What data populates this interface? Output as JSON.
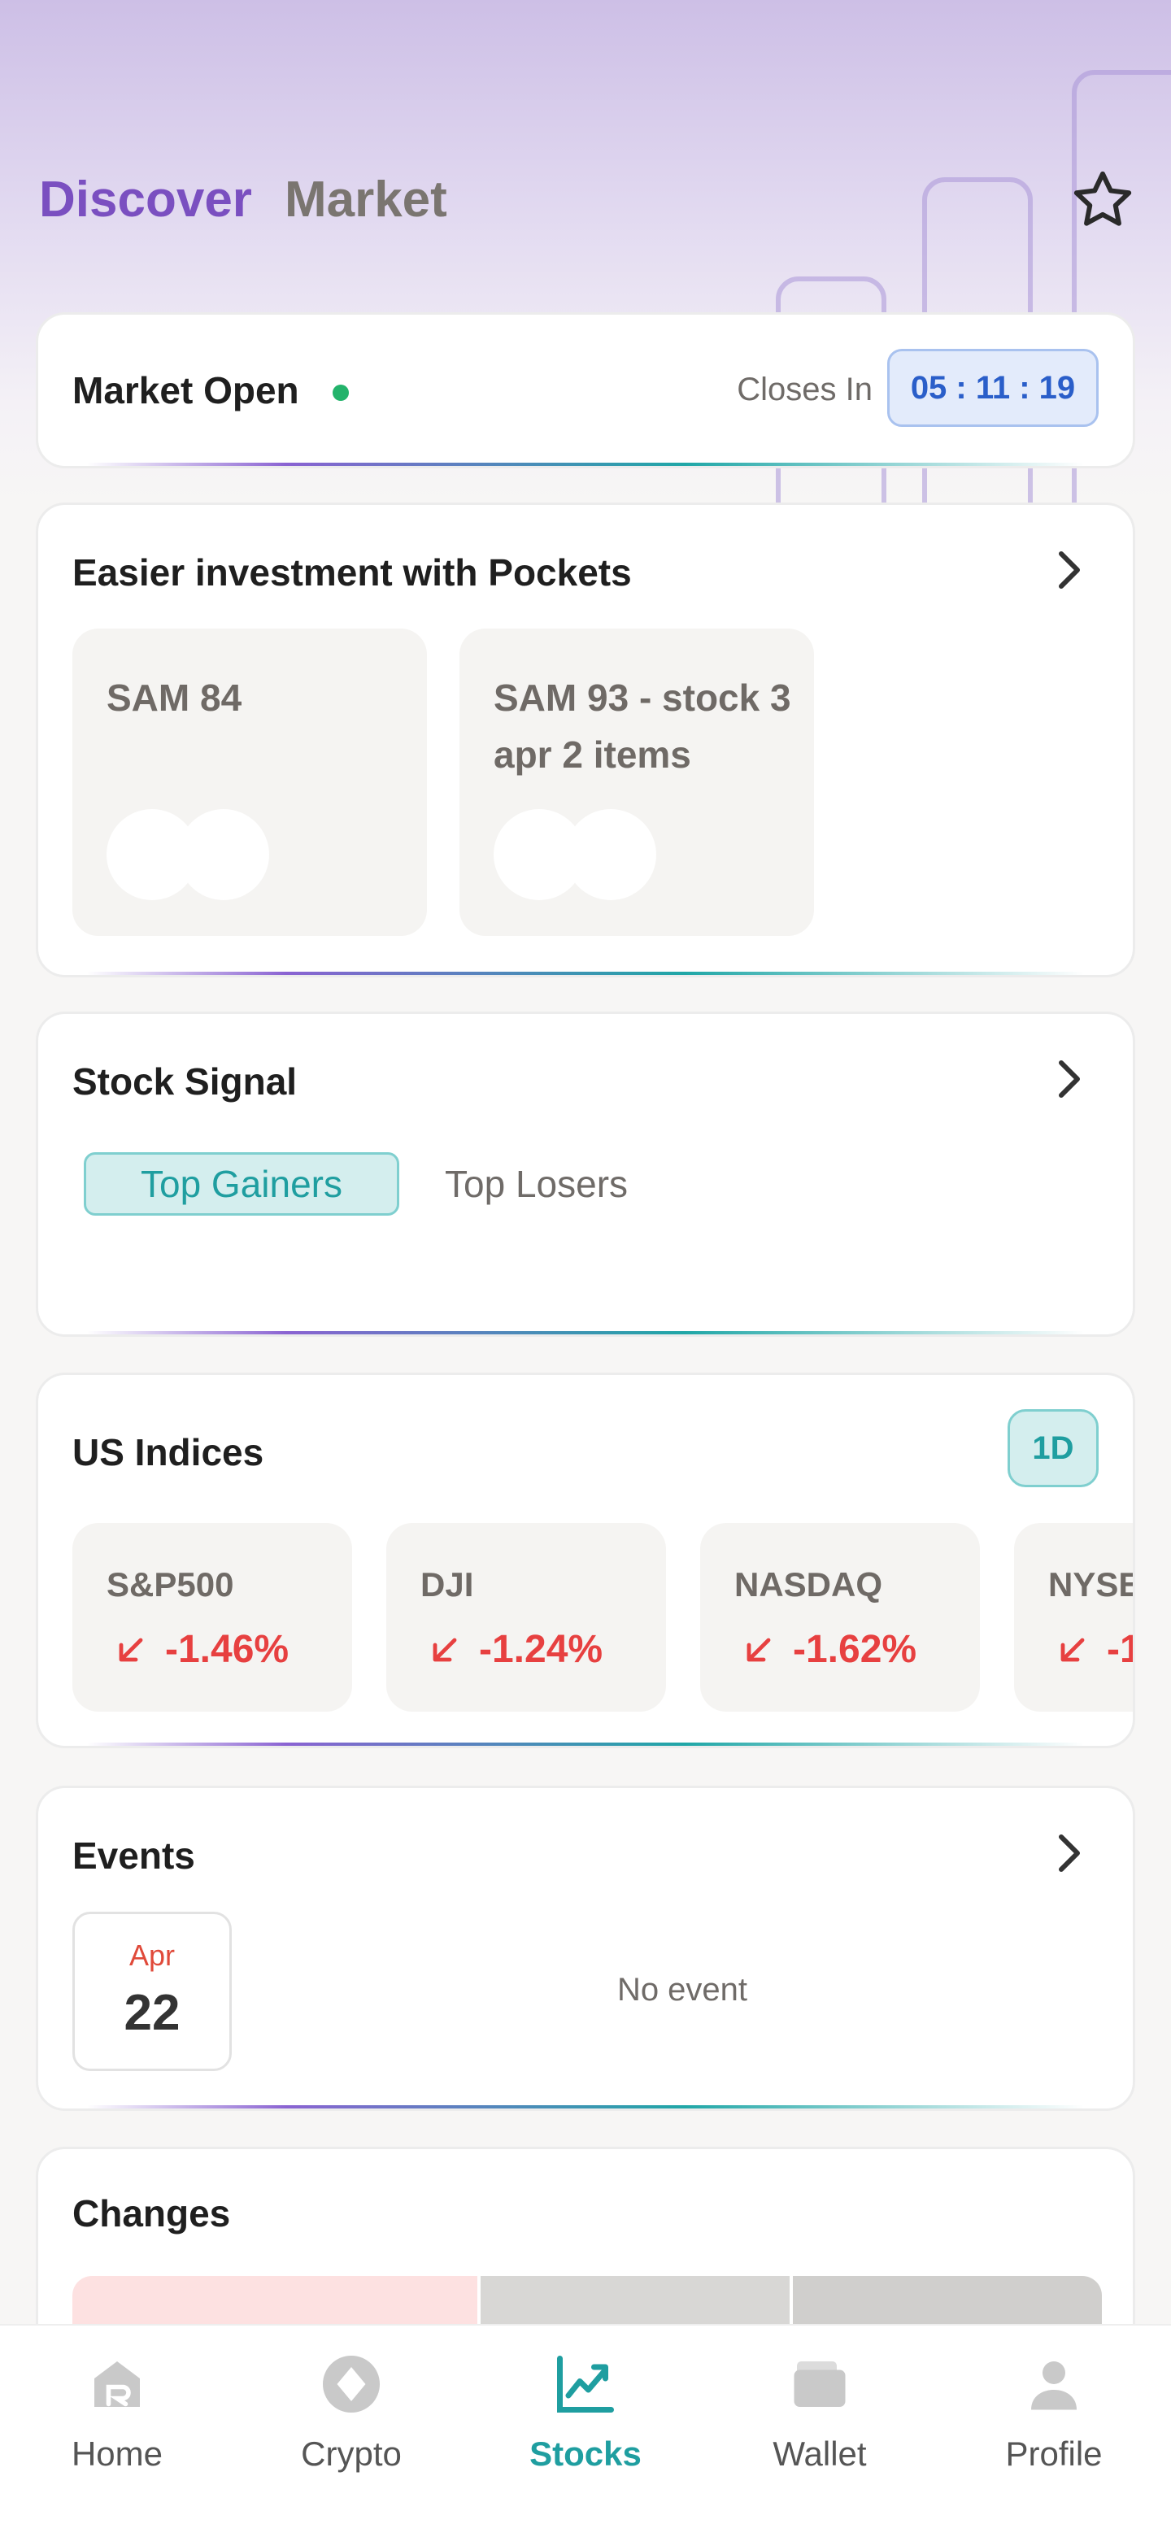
{
  "header": {
    "tabs": [
      {
        "label": "Discover",
        "active": true
      },
      {
        "label": "Market",
        "active": false
      }
    ],
    "favorite_icon": "star-icon"
  },
  "market_status": {
    "label": "Market Open",
    "status_color": "#23b36b",
    "closes_label": "Closes In",
    "countdown": "05 : 11 : 19"
  },
  "pockets": {
    "title": "Easier investment with Pockets",
    "items": [
      {
        "name": "SAM 84"
      },
      {
        "name": "SAM 93 - stock 3 apr 2 items"
      }
    ]
  },
  "stock_signal": {
    "title": "Stock Signal",
    "tabs": [
      {
        "label": "Top Gainers",
        "active": true
      },
      {
        "label": "Top Losers",
        "active": false
      }
    ]
  },
  "us_indices": {
    "title": "US Indices",
    "period": "1D",
    "items": [
      {
        "name": "S&P500",
        "change": "-1.46%"
      },
      {
        "name": "DJI",
        "change": "-1.24%"
      },
      {
        "name": "NASDAQ",
        "change": "-1.62%"
      },
      {
        "name": "NYSE",
        "change": "-1"
      }
    ],
    "negative_color": "#e74040"
  },
  "events": {
    "title": "Events",
    "month": "Apr",
    "day": "22",
    "empty_text": "No event"
  },
  "changes": {
    "title": "Changes"
  },
  "bottom_nav": {
    "items": [
      {
        "label": "Home",
        "icon": "home-icon",
        "active": false
      },
      {
        "label": "Crypto",
        "icon": "crypto-icon",
        "active": false
      },
      {
        "label": "Stocks",
        "icon": "stocks-chart-icon",
        "active": true
      },
      {
        "label": "Wallet",
        "icon": "wallet-icon",
        "active": false
      },
      {
        "label": "Profile",
        "icon": "profile-icon",
        "active": false
      }
    ]
  },
  "colors": {
    "accent_purple": "#7a4fc0",
    "accent_teal": "#1f9ea0",
    "timer_blue": "#2a5ec9"
  }
}
